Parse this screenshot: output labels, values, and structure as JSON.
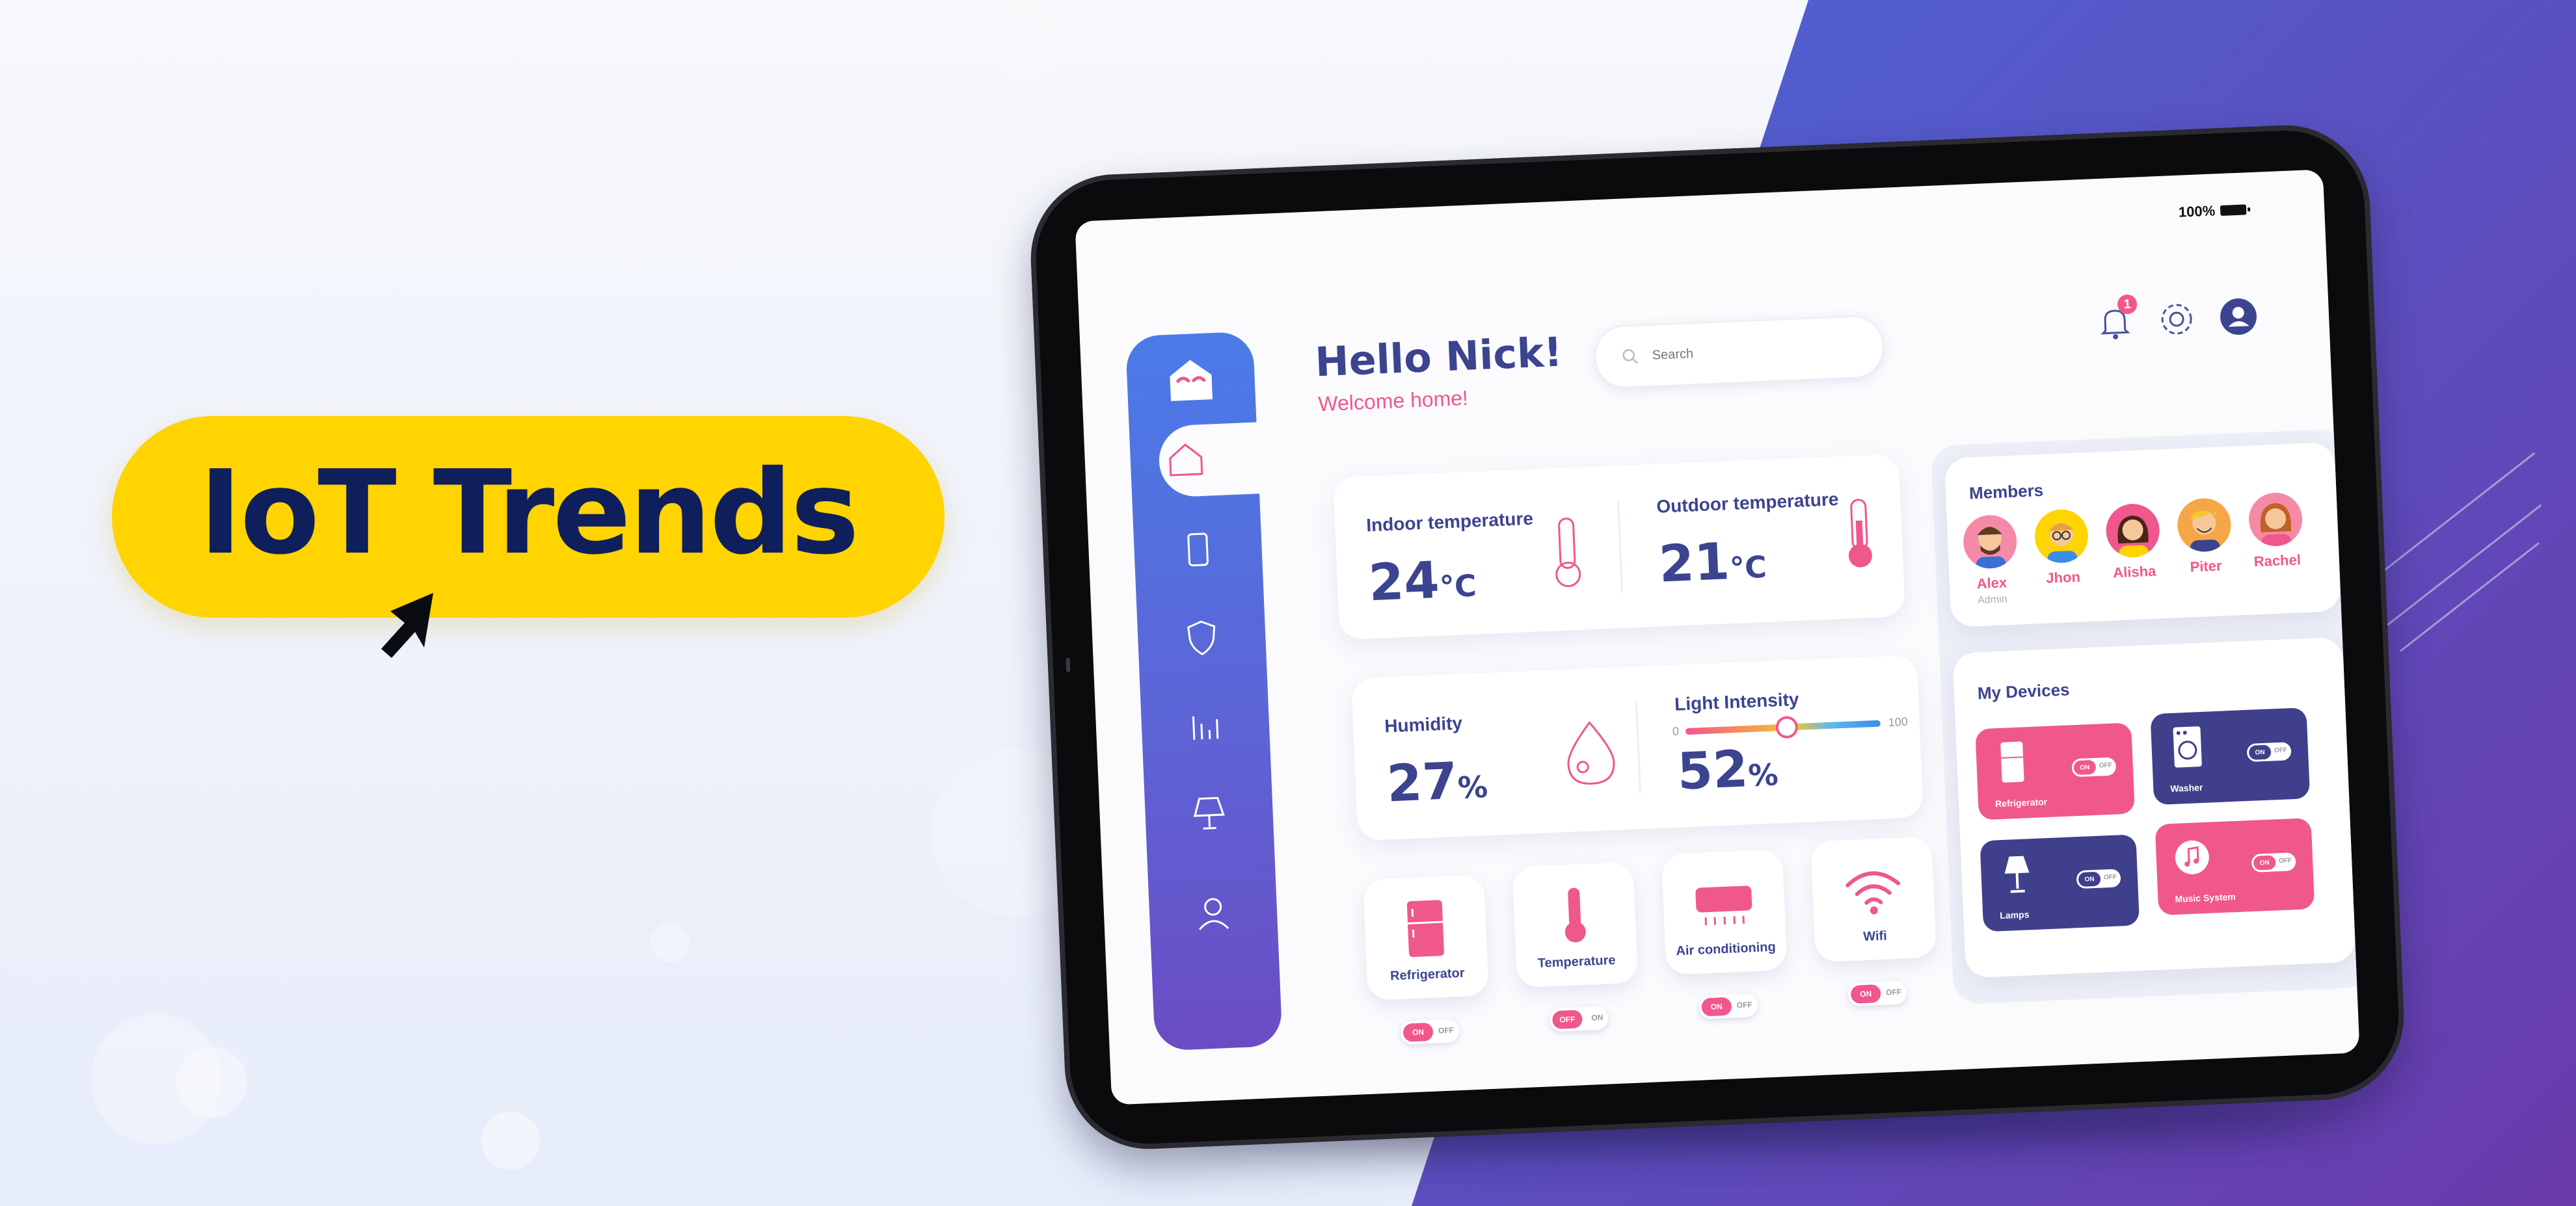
{
  "banner": {
    "title": "IoT Trends"
  },
  "status_bar": {
    "battery": "100%"
  },
  "header": {
    "greeting": "Hello Nick!",
    "subtitle": "Welcome home!",
    "search_placeholder": "Search",
    "notification_count": "1"
  },
  "sidebar": {
    "items": [
      "home-icon",
      "tablet-icon",
      "shield-icon",
      "stats-icon",
      "lamp-icon",
      "user-icon"
    ]
  },
  "metrics": {
    "indoor": {
      "label": "Indoor temperature",
      "value": "24",
      "unit": "°C"
    },
    "outdoor": {
      "label": "Outdoor temperature",
      "value": "21",
      "unit": "°C"
    },
    "humidity": {
      "label": "Humidity",
      "value": "27",
      "unit": "%"
    },
    "light": {
      "label": "Light Intensity",
      "value": "52",
      "unit": "%",
      "min": "0",
      "max": "100",
      "level": 0.52
    }
  },
  "quick_devices": [
    {
      "label": "Refrigerator",
      "on": "ON",
      "off": "OFF"
    },
    {
      "label": "Temperature",
      "on": "OFF",
      "off": "ON"
    },
    {
      "label": "Air conditioning",
      "on": "ON",
      "off": "OFF"
    },
    {
      "label": "Wifi",
      "on": "ON",
      "off": "OFF"
    }
  ],
  "members": {
    "title": "Members",
    "list": [
      {
        "name": "Alex",
        "role": "Admin"
      },
      {
        "name": "Jhon",
        "role": ""
      },
      {
        "name": "Alisha",
        "role": ""
      },
      {
        "name": "Piter",
        "role": ""
      },
      {
        "name": "Rachel",
        "role": ""
      }
    ]
  },
  "my_devices": {
    "title": "My Devices",
    "list": [
      {
        "label": "Refrigerator",
        "on": "ON",
        "off": "OFF",
        "color": "#f0578c"
      },
      {
        "label": "Washer",
        "on": "ON",
        "off": "OFF",
        "color": "#3f3f8c"
      },
      {
        "label": "Lamps",
        "on": "ON",
        "off": "OFF",
        "color": "#3f3f8c"
      },
      {
        "label": "Music System",
        "on": "ON",
        "off": "OFF",
        "color": "#f0578c"
      }
    ]
  },
  "colors": {
    "accent_pink": "#f0578c",
    "navy": "#3c4490",
    "banner_yellow": "#ffd400",
    "banner_text": "#0f1f5c"
  }
}
